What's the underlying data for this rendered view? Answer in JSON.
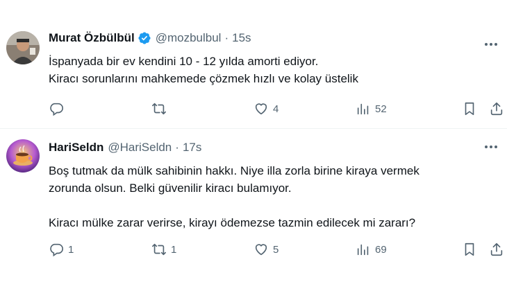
{
  "tweets": [
    {
      "author": {
        "name": "Murat Özbülbül",
        "handle": "@mozbulbul",
        "verified": true
      },
      "time": "15s",
      "lines": [
        "İspanyada bir ev kendini 10 - 12 yılda amorti ediyor.",
        "Kiracı sorunlarını mahkemede çözmek hızlı ve kolay üstelik"
      ],
      "stats": {
        "replies": "",
        "retweets": "",
        "likes": "4",
        "views": "52"
      }
    },
    {
      "author": {
        "name": "HariSeldn",
        "handle": "@HariSeldn",
        "verified": false
      },
      "time": "17s",
      "lines": [
        "Boş tutmak da mülk sahibinin hakkı. Niye illa zorla birine kiraya vermek",
        "zorunda olsun. Belki güvenilir kiracı bulamıyor.",
        "Kiracı mülke zarar verirse, kirayı ödemezse tazmin edilecek mi zararı?"
      ],
      "stats": {
        "replies": "1",
        "retweets": "1",
        "likes": "5",
        "views": "69"
      }
    }
  ],
  "separator": "·",
  "colors": {
    "text": "#0f1419",
    "secondary": "#536471",
    "verified": "#1d9bf0",
    "divider": "#eff3f4"
  }
}
